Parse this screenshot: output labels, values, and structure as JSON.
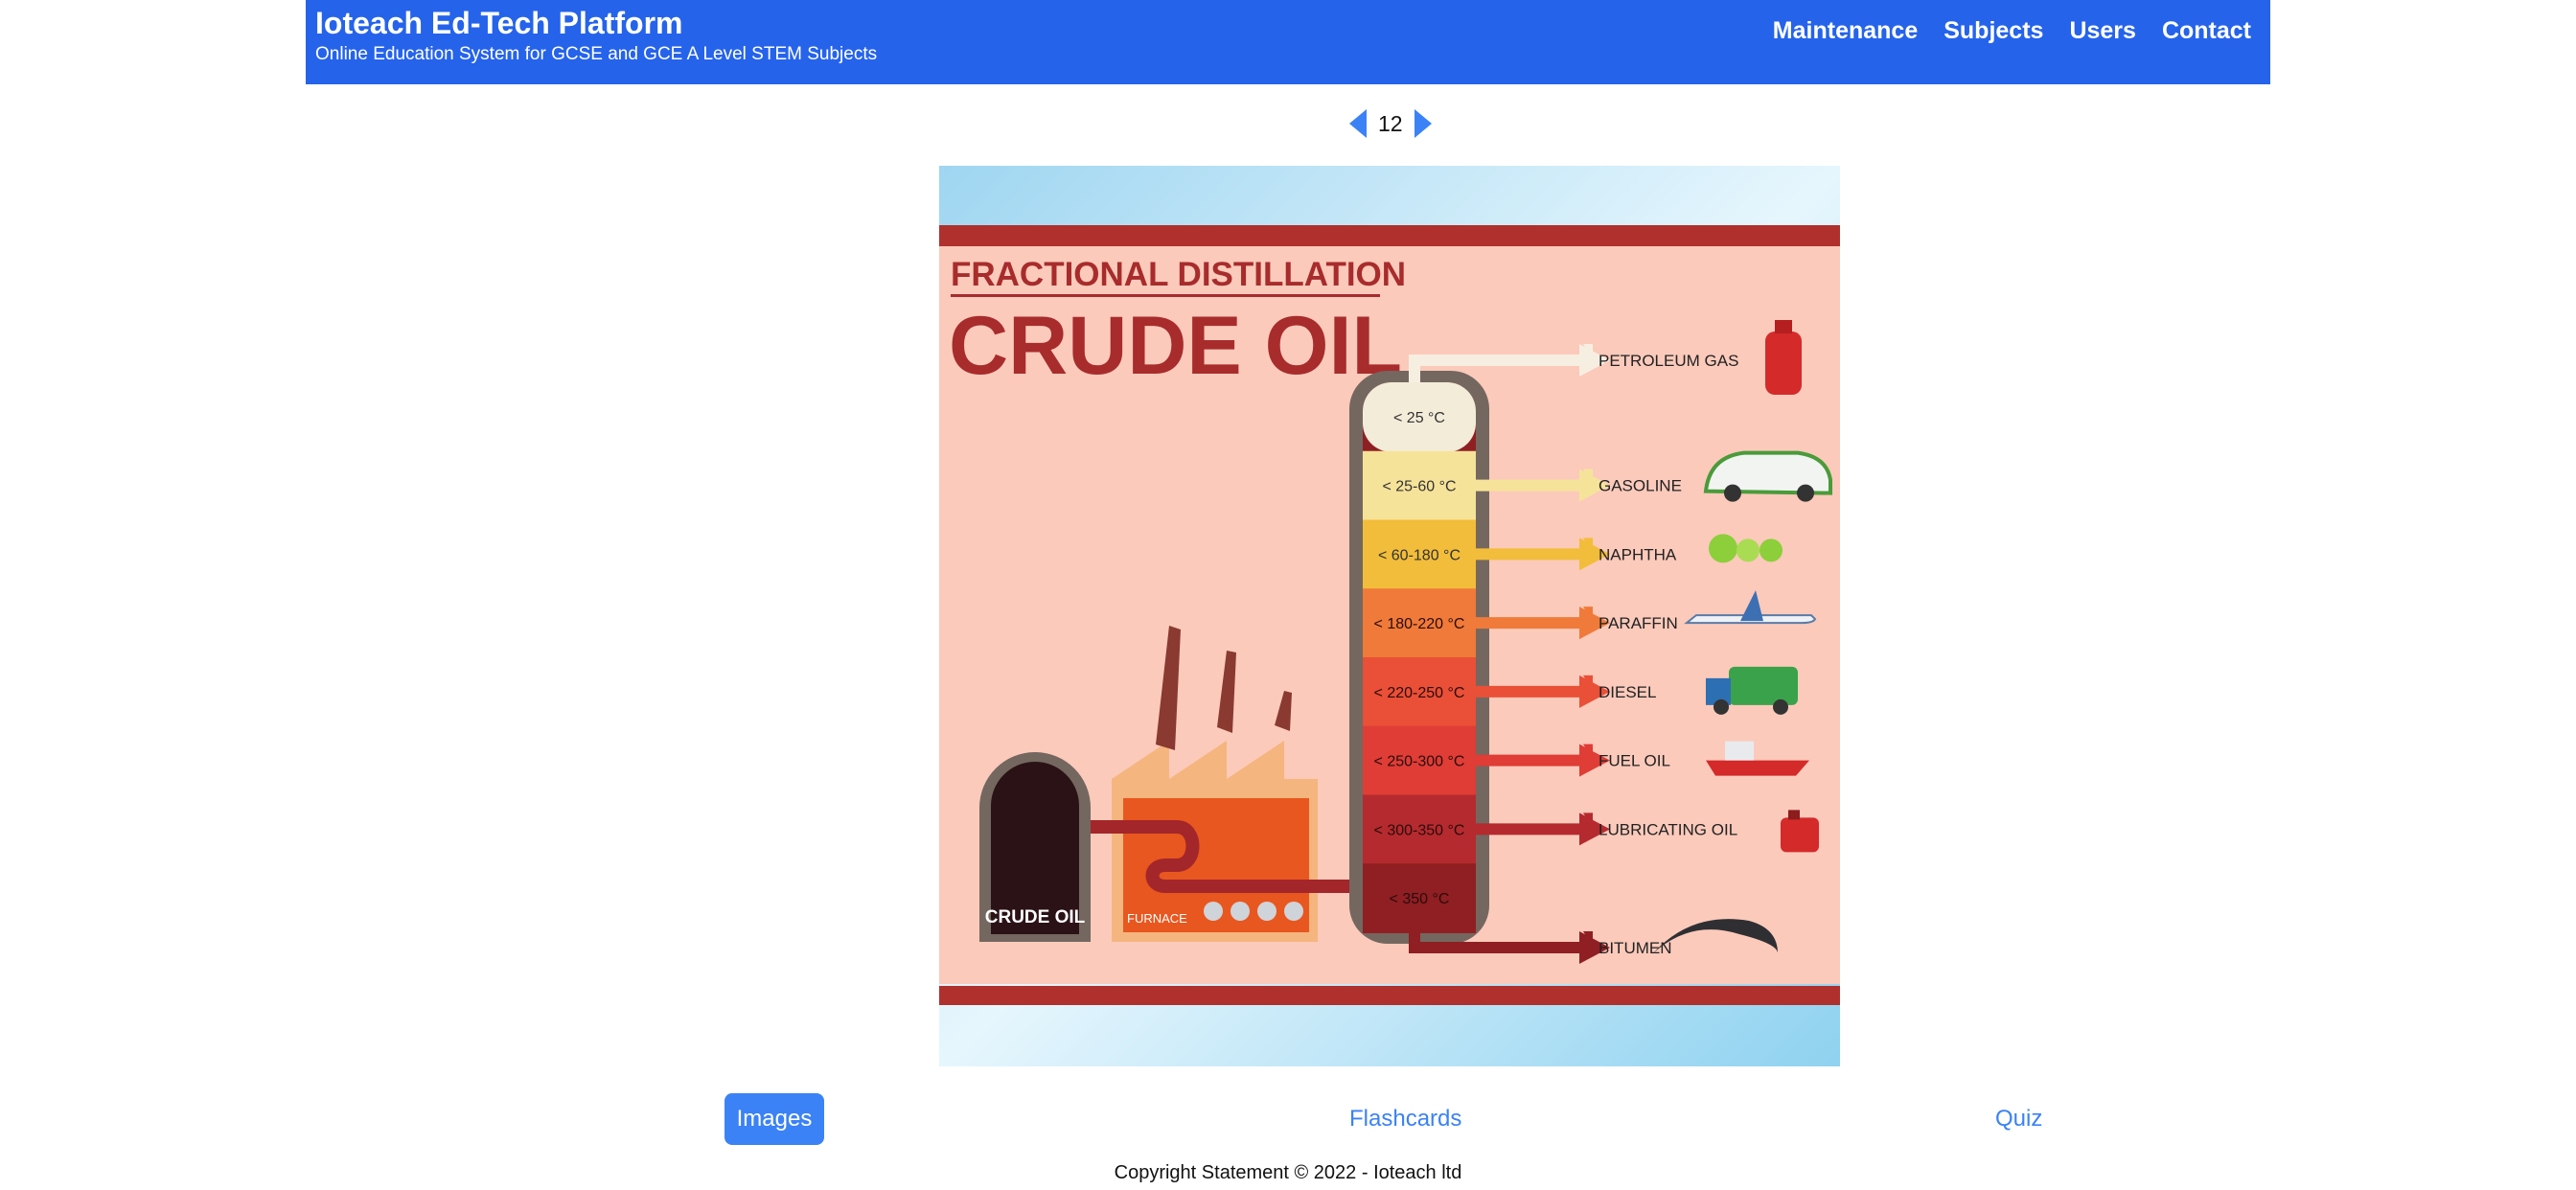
{
  "header": {
    "title": "Ioteach Ed-Tech Platform",
    "subtitle": "Online Education System for GCSE and GCE A Level STEM Subjects",
    "nav": [
      "Maintenance",
      "Subjects",
      "Users",
      "Contact"
    ],
    "color": "#2563eb"
  },
  "pager": {
    "page": "12"
  },
  "slide": {
    "heading_small": "FRACTIONAL DISTILLATION",
    "heading_large": "CRUDE OIL",
    "tank_label": "CRUDE OIL",
    "furnace_label": "FURNACE",
    "fractions": [
      {
        "temp": "< 25 °C",
        "product": "PETROLEUM GAS",
        "icon": "gas-cylinder-icon",
        "color": "#f3ecd9"
      },
      {
        "temp": "< 25-60 °C",
        "product": "GASOLINE",
        "icon": "car-icon",
        "color": "#f6e39a"
      },
      {
        "temp": "< 60-180 °C",
        "product": "NAPHTHA",
        "icon": "flask-icon",
        "color": "#f2bd3a"
      },
      {
        "temp": "< 180-220 °C",
        "product": "PARAFFIN",
        "icon": "airplane-icon",
        "color": "#f07a3a"
      },
      {
        "temp": "< 220-250 °C",
        "product": "DIESEL",
        "icon": "truck-icon",
        "color": "#ea4f37"
      },
      {
        "temp": "< 250-300 °C",
        "product": "FUEL OIL",
        "icon": "ship-icon",
        "color": "#df3d36"
      },
      {
        "temp": "< 300-350 °C",
        "product": "LUBRICATING OIL",
        "icon": "oil-can-icon",
        "color": "#b52a2e"
      },
      {
        "temp": "< 350 °C",
        "product": "BITUMEN",
        "icon": "road-icon",
        "color": "#8f1f22"
      }
    ]
  },
  "tabs": {
    "images": "Images",
    "flashcards": "Flashcards",
    "quiz": "Quiz"
  },
  "footer": {
    "copyright": "Copyright Statement © 2022 - Ioteach ltd"
  }
}
